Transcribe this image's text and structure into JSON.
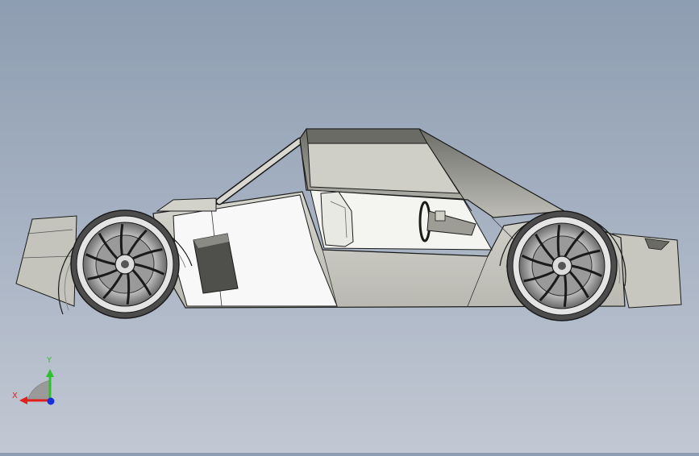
{
  "viewport": {
    "model": "race-car-side-view",
    "background_top": "#8e9db1",
    "background_bottom": "#c2c8d3"
  },
  "triad": {
    "x_label": "X",
    "y_label": "Y",
    "x_color": "#e0201b",
    "y_color": "#2fbf2f",
    "z_color": "#1730d8"
  },
  "colors": {
    "body_shade": "#c9c9c1",
    "body_light": "#f7f7f7",
    "body_dark": "#8f8f88",
    "glass": "#a8a8a1",
    "outline": "#1a1a1a"
  }
}
